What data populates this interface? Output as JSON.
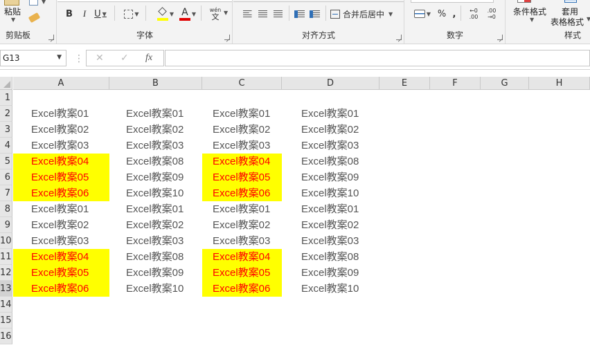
{
  "ribbon": {
    "clipboard": {
      "paste_label": "粘贴",
      "group_label": "剪贴板"
    },
    "font": {
      "group_label": "字体",
      "bold": "B",
      "italic": "I",
      "underline": "U",
      "font_color_letter": "A",
      "phonetic_top": "wén",
      "phonetic_bottom": "文"
    },
    "alignment": {
      "merge_label": "合并后居中",
      "group_label": "对齐方式"
    },
    "number": {
      "percent": "%",
      "comma": ",",
      "inc_decimal": ".00",
      "dec_decimal": ".00",
      "group_label": "数字"
    },
    "styles": {
      "conditional_format": "条件格式",
      "table_format_line1": "套用",
      "table_format_line2": "表格格式",
      "group_label": "样式"
    },
    "colors": {
      "highlight": "#ffff00",
      "font_color": "#ff0000"
    }
  },
  "formula_bar": {
    "name_box": "G13",
    "cancel": "✕",
    "enter": "✓",
    "fx": "fx",
    "formula": ""
  },
  "columns": [
    "A",
    "B",
    "C",
    "D",
    "E",
    "F",
    "G",
    "H"
  ],
  "rows": [
    "1",
    "2",
    "3",
    "4",
    "5",
    "6",
    "7",
    "8",
    "9",
    "10",
    "11",
    "12",
    "13",
    "14",
    "15",
    "16"
  ],
  "cells": {
    "A": [
      "",
      "Excel教案01",
      "Excel教案02",
      "Excel教案03",
      "Excel教案04",
      "Excel教案05",
      "Excel教案06",
      "Excel教案01",
      "Excel教案02",
      "Excel教案03",
      "Excel教案04",
      "Excel教案05",
      "Excel教案06"
    ],
    "B": [
      "",
      "Excel教案01",
      "Excel教案02",
      "Excel教案03",
      "Excel教案08",
      "Excel教案09",
      "Excel教案10",
      "Excel教案01",
      "Excel教案02",
      "Excel教案03",
      "Excel教案08",
      "Excel教案09",
      "Excel教案10"
    ],
    "C": [
      "",
      "Excel教案01",
      "Excel教案02",
      "Excel教案03",
      "Excel教案04",
      "Excel教案05",
      "Excel教案06",
      "Excel教案01",
      "Excel教案02",
      "Excel教案03",
      "Excel教案04",
      "Excel教案05",
      "Excel教案06"
    ],
    "D": [
      "",
      "Excel教案01",
      "Excel教案02",
      "Excel教案03",
      "Excel教案08",
      "Excel教案09",
      "Excel教案10",
      "Excel教案01",
      "Excel教案02",
      "Excel教案03",
      "Excel教案08",
      "Excel教案09",
      "Excel教案10"
    ]
  },
  "highlighted_rows": [
    5,
    6,
    7,
    11,
    12,
    13
  ],
  "highlighted_columns": [
    "A",
    "C"
  ],
  "selected_row": 13,
  "cell_colors": {
    "normal_text": "#555555",
    "highlight_fill": "#ffff00",
    "highlight_text": "#ff0000"
  }
}
